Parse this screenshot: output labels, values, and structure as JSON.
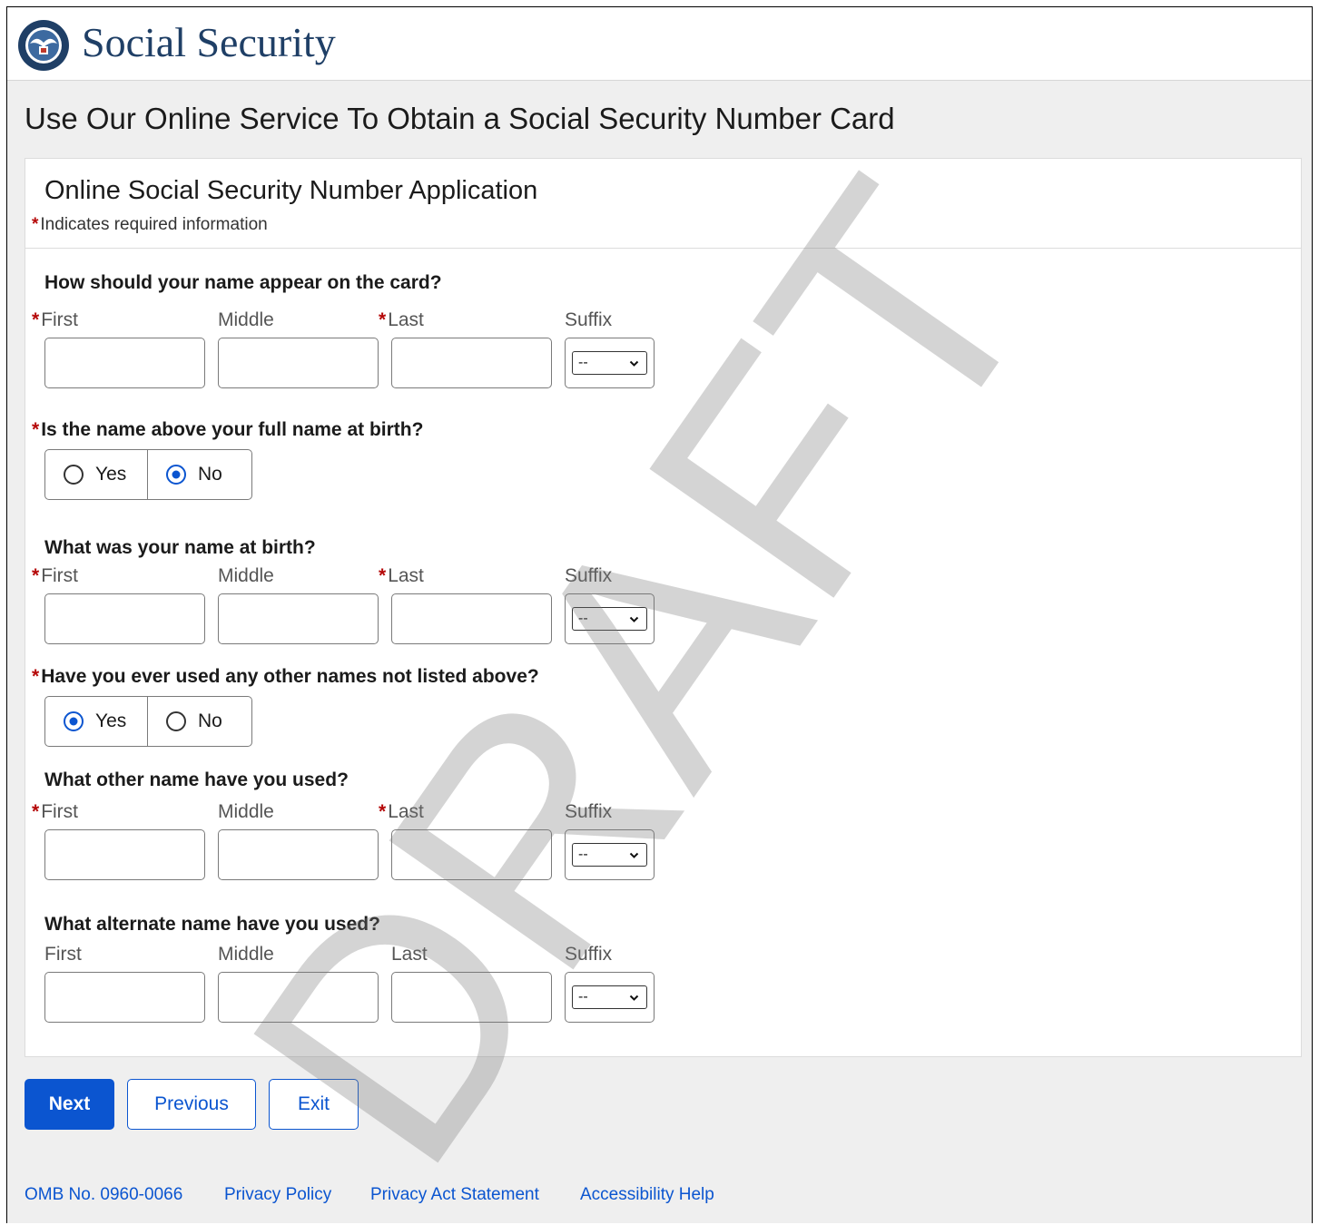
{
  "header": {
    "brand": "Social Security",
    "seal_icon": "ssa-seal-icon"
  },
  "page_title": "Use Our Online Service To Obtain a Social Security Number Card",
  "form": {
    "title": "Online Social Security Number Application",
    "required_note": "Indicates required information",
    "required_marker": "*",
    "card_name": {
      "question": "How should your name appear on the card?",
      "first_label": "First",
      "middle_label": "Middle",
      "last_label": "Last",
      "suffix_label": "Suffix",
      "first_value": "",
      "middle_value": "",
      "last_value": "",
      "suffix_value": "--"
    },
    "full_name_at_birth": {
      "question": "Is the name above your full name at birth?",
      "options": [
        "Yes",
        "No"
      ],
      "selected": "No"
    },
    "birth_name": {
      "question": "What was your name at birth?",
      "first_label": "First",
      "middle_label": "Middle",
      "last_label": "Last",
      "suffix_label": "Suffix",
      "first_value": "",
      "middle_value": "",
      "last_value": "",
      "suffix_value": "--"
    },
    "other_names_used": {
      "question": "Have you ever used any other names not listed above?",
      "options": [
        "Yes",
        "No"
      ],
      "selected": "Yes"
    },
    "other_name": {
      "question": "What other name have you used?",
      "first_label": "First",
      "middle_label": "Middle",
      "last_label": "Last",
      "suffix_label": "Suffix",
      "first_value": "",
      "middle_value": "",
      "last_value": "",
      "suffix_value": "--"
    },
    "alternate_name": {
      "question": "What alternate name have you used?",
      "first_label": "First",
      "middle_label": "Middle",
      "last_label": "Last",
      "suffix_label": "Suffix",
      "first_value": "",
      "middle_value": "",
      "last_value": "",
      "suffix_value": "--"
    }
  },
  "actions": {
    "next": "Next",
    "previous": "Previous",
    "exit": "Exit"
  },
  "footer": {
    "omb": "OMB No. 0960-0066",
    "privacy_policy": "Privacy Policy",
    "privacy_act": "Privacy Act Statement",
    "accessibility": "Accessibility Help"
  },
  "watermark": "DRAFT",
  "colors": {
    "brand_blue": "#1f3f66",
    "primary": "#0b55d0",
    "required": "#b50909",
    "background": "#efefef"
  }
}
